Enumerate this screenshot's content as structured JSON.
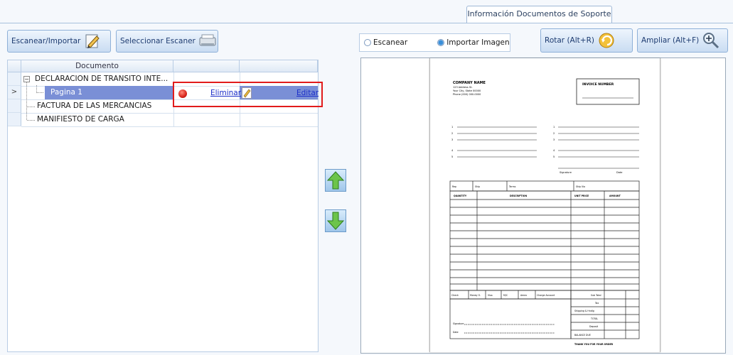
{
  "tab": {
    "label": "Información Documentos de Soporte"
  },
  "toolbar": {
    "scan_import_label": "Escanear/Importar",
    "select_scanner_label": "Seleccionar Escaner",
    "rotate_label": "Rotar (Alt+R)",
    "zoom_label": "Ampliar (Alt+F)"
  },
  "mode": {
    "scan_label": "Escanear",
    "import_label": "Importar Imagen",
    "selected": "Importar Imagen"
  },
  "grid": {
    "column_header": "Documento",
    "rows": [
      {
        "label": "DECLARACION DE TRANSITO INTE...",
        "level": 0,
        "expander": "⊟"
      },
      {
        "label": "Pagina 1",
        "level": 1,
        "selected": true,
        "delete_label": "Eliminar",
        "edit_label": "Editar"
      },
      {
        "label": "FACTURA DE LAS MERCANCIAS",
        "level": 0
      },
      {
        "label": "MANIFIESTO DE CARGA",
        "level": 0
      }
    ],
    "current_row_indicator": ">"
  },
  "preview": {
    "company": "COMPANY NAME",
    "company_lines": [
      "123 Address St.",
      "Your City, State 00000",
      "Phone (000) 000-0000"
    ],
    "invoice_label": "INVOICE NUMBER",
    "left_lines": [
      "1",
      "2",
      "3",
      "4",
      "5"
    ],
    "right_lines": [
      "1",
      "2",
      "3",
      "4",
      "5"
    ],
    "sig_labels": [
      "Signature",
      "Date"
    ],
    "info_cols": [
      "Rep",
      "Ship",
      "Terms",
      "Ship Via"
    ],
    "item_headers": [
      "QUANTITY",
      "DESCRIPTION",
      "UNIT PRICE",
      "AMOUNT"
    ],
    "bottom_cols": [
      "Check",
      "Money O.",
      "Visa",
      "M/C",
      "Amex",
      "Charge Account"
    ],
    "totals": [
      "Sub Total",
      "Tax",
      "Shipping & Hndlg",
      "TOTAL",
      "Deposit",
      "BALANCE DUE"
    ],
    "sign_lines": [
      "Signature",
      "Date"
    ],
    "thanks": "THANK YOU FOR YOUR ORDER"
  },
  "colors": {
    "accent": "#3a8fd9",
    "selection": "#7a8fd6",
    "highlight_border": "#e11b1b"
  }
}
